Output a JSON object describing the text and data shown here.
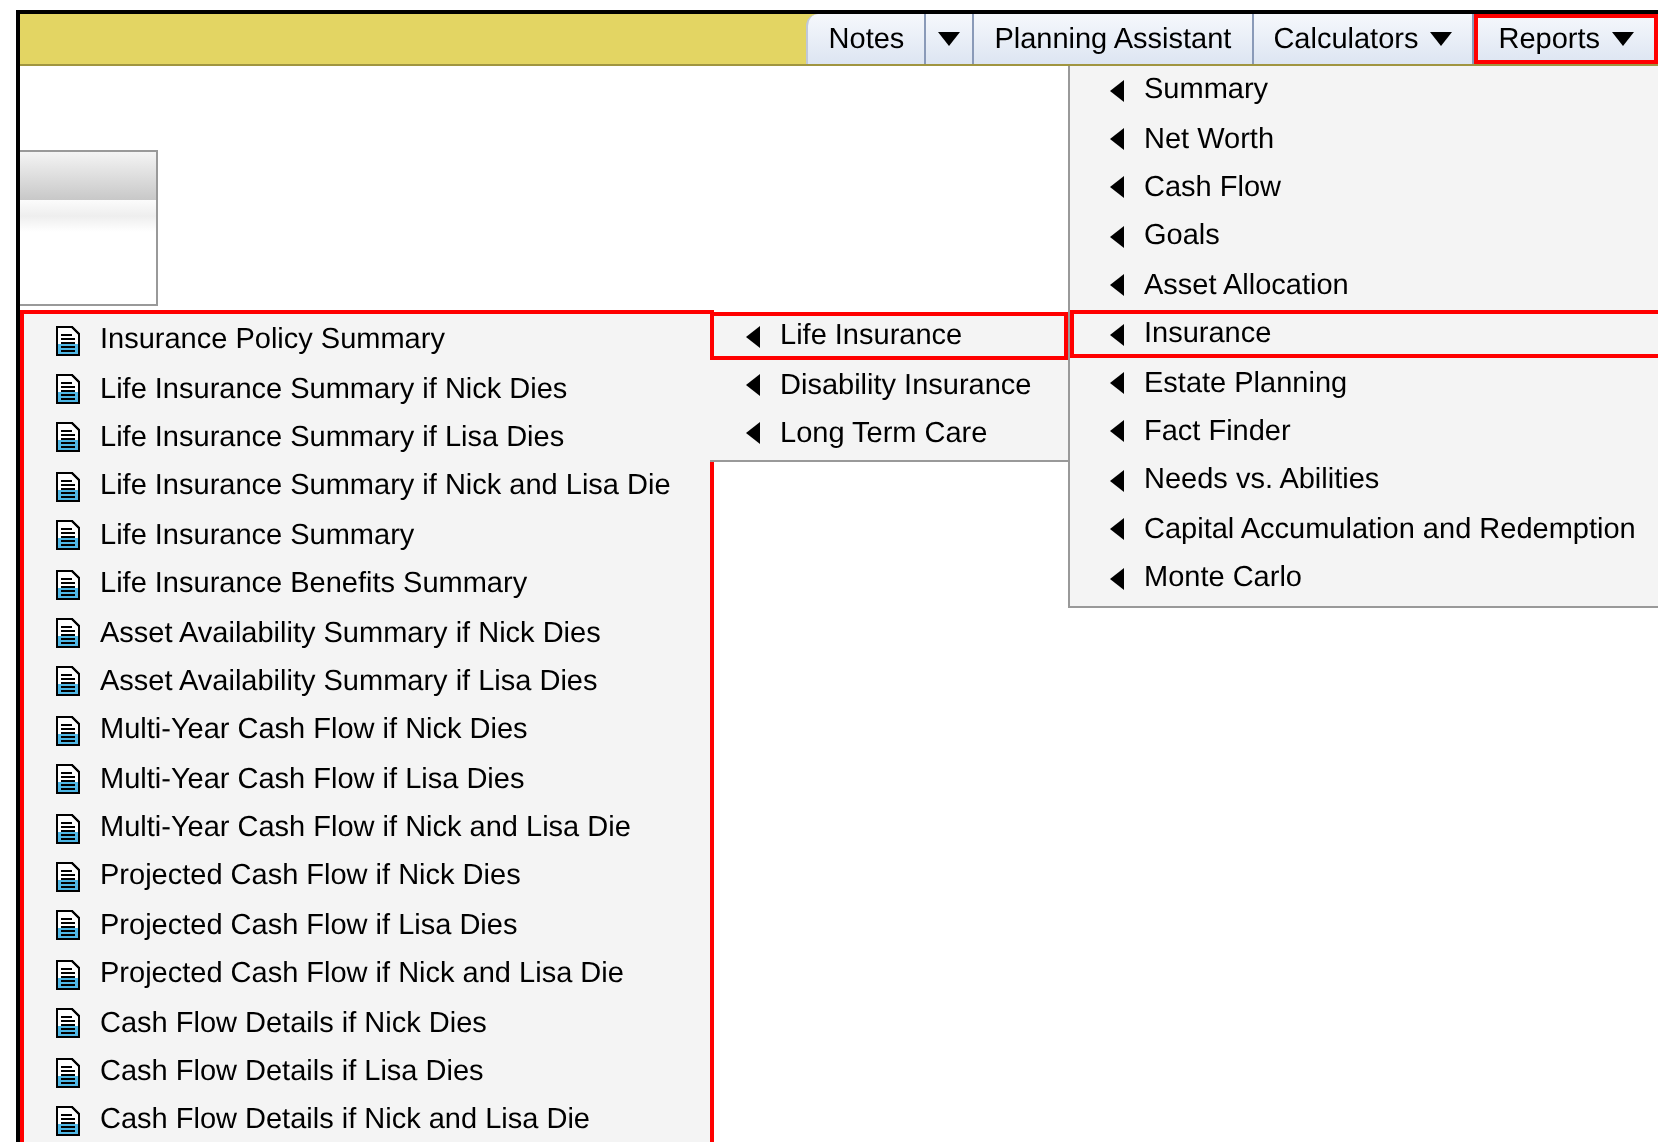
{
  "toolbar": {
    "buttons": [
      {
        "label": "Notes",
        "kind": "split",
        "highlighted": false
      },
      {
        "label": "Planning Assistant",
        "kind": "plain",
        "highlighted": false
      },
      {
        "label": "Calculators",
        "kind": "dropdown",
        "highlighted": false
      },
      {
        "label": "Reports",
        "kind": "dropdown",
        "highlighted": true
      }
    ]
  },
  "reports_menu": {
    "items": [
      {
        "label": "Summary",
        "highlighted": false
      },
      {
        "label": "Net Worth",
        "highlighted": false
      },
      {
        "label": "Cash Flow",
        "highlighted": false
      },
      {
        "label": "Goals",
        "highlighted": false
      },
      {
        "label": "Asset Allocation",
        "highlighted": false
      },
      {
        "label": "Insurance",
        "highlighted": true
      },
      {
        "label": "Estate Planning",
        "highlighted": false
      },
      {
        "label": "Fact Finder",
        "highlighted": false
      },
      {
        "label": "Needs vs. Abilities",
        "highlighted": false
      },
      {
        "label": "Capital Accumulation and Redemption",
        "highlighted": false
      },
      {
        "label": "Monte Carlo",
        "highlighted": false
      }
    ]
  },
  "insurance_menu": {
    "items": [
      {
        "label": "Life Insurance",
        "highlighted": true
      },
      {
        "label": "Disability Insurance",
        "highlighted": false
      },
      {
        "label": "Long Term Care",
        "highlighted": false
      }
    ]
  },
  "life_insurance_menu": {
    "highlighted": true,
    "items": [
      {
        "label": "Insurance Policy Summary"
      },
      {
        "label": "Life Insurance Summary if Nick Dies"
      },
      {
        "label": "Life Insurance Summary if Lisa Dies"
      },
      {
        "label": "Life Insurance Summary if Nick and Lisa Die"
      },
      {
        "label": "Life Insurance Summary"
      },
      {
        "label": "Life Insurance Benefits Summary"
      },
      {
        "label": "Asset Availability Summary if Nick Dies"
      },
      {
        "label": "Asset Availability Summary if Lisa Dies"
      },
      {
        "label": "Multi-Year Cash Flow if Nick Dies"
      },
      {
        "label": "Multi-Year Cash Flow if Lisa Dies"
      },
      {
        "label": "Multi-Year Cash Flow if Nick and Lisa Die"
      },
      {
        "label": "Projected Cash Flow if Nick Dies"
      },
      {
        "label": "Projected Cash Flow if Lisa Dies"
      },
      {
        "label": "Projected Cash Flow if Nick and Lisa Die"
      },
      {
        "label": "Cash Flow Details if Nick Dies"
      },
      {
        "label": "Cash Flow Details if Lisa Dies"
      },
      {
        "label": "Cash Flow Details if Nick and Lisa Die"
      }
    ]
  }
}
